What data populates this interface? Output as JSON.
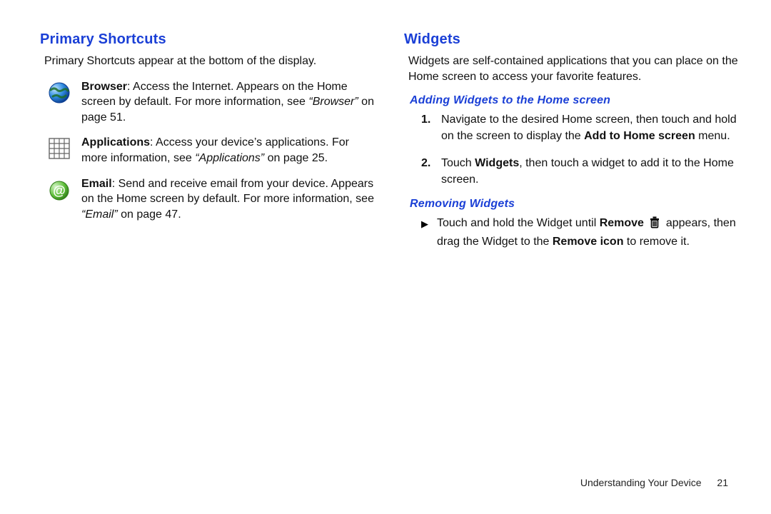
{
  "left": {
    "heading": "Primary Shortcuts",
    "intro": "Primary Shortcuts appear at the bottom of the display.",
    "items": [
      {
        "icon": "globe-icon",
        "title": "Browser",
        "desc": ": Access the Internet. Appears on the Home screen by default. For more information, see ",
        "ref": "“Browser”",
        "ref_tail": " on page 51."
      },
      {
        "icon": "grid-icon",
        "title": "Applications",
        "desc": ": Access your device’s applications. For more information, see ",
        "ref": "“Applications”",
        "ref_tail": " on page 25."
      },
      {
        "icon": "email-icon",
        "title": "Email",
        "desc": ": Send and receive email from your device. Appears on the Home screen by default. For more information, see ",
        "ref": "“Email”",
        "ref_tail": " on page 47."
      }
    ]
  },
  "right": {
    "heading": "Widgets",
    "intro": "Widgets are self-contained applications that you can place on the Home screen to access your favorite features.",
    "sub1": {
      "heading": "Adding Widgets to the Home screen",
      "steps": [
        {
          "num": "1.",
          "pre": "Navigate to the desired Home screen, then touch and hold on the screen to display the ",
          "bold": "Add to Home screen",
          "post": " menu."
        },
        {
          "num": "2.",
          "pre": "Touch ",
          "bold": "Widgets",
          "post": ", then touch a widget to add it to the Home screen."
        }
      ]
    },
    "sub2": {
      "heading": "Removing Widgets",
      "bullet": {
        "pre": "Touch and hold the Widget until ",
        "bold1": "Remove",
        "mid": " appears, then drag the Widget to the ",
        "bold2": "Remove icon",
        "post": " to remove it."
      }
    }
  },
  "footer": {
    "section": "Understanding Your Device",
    "page": "21"
  }
}
